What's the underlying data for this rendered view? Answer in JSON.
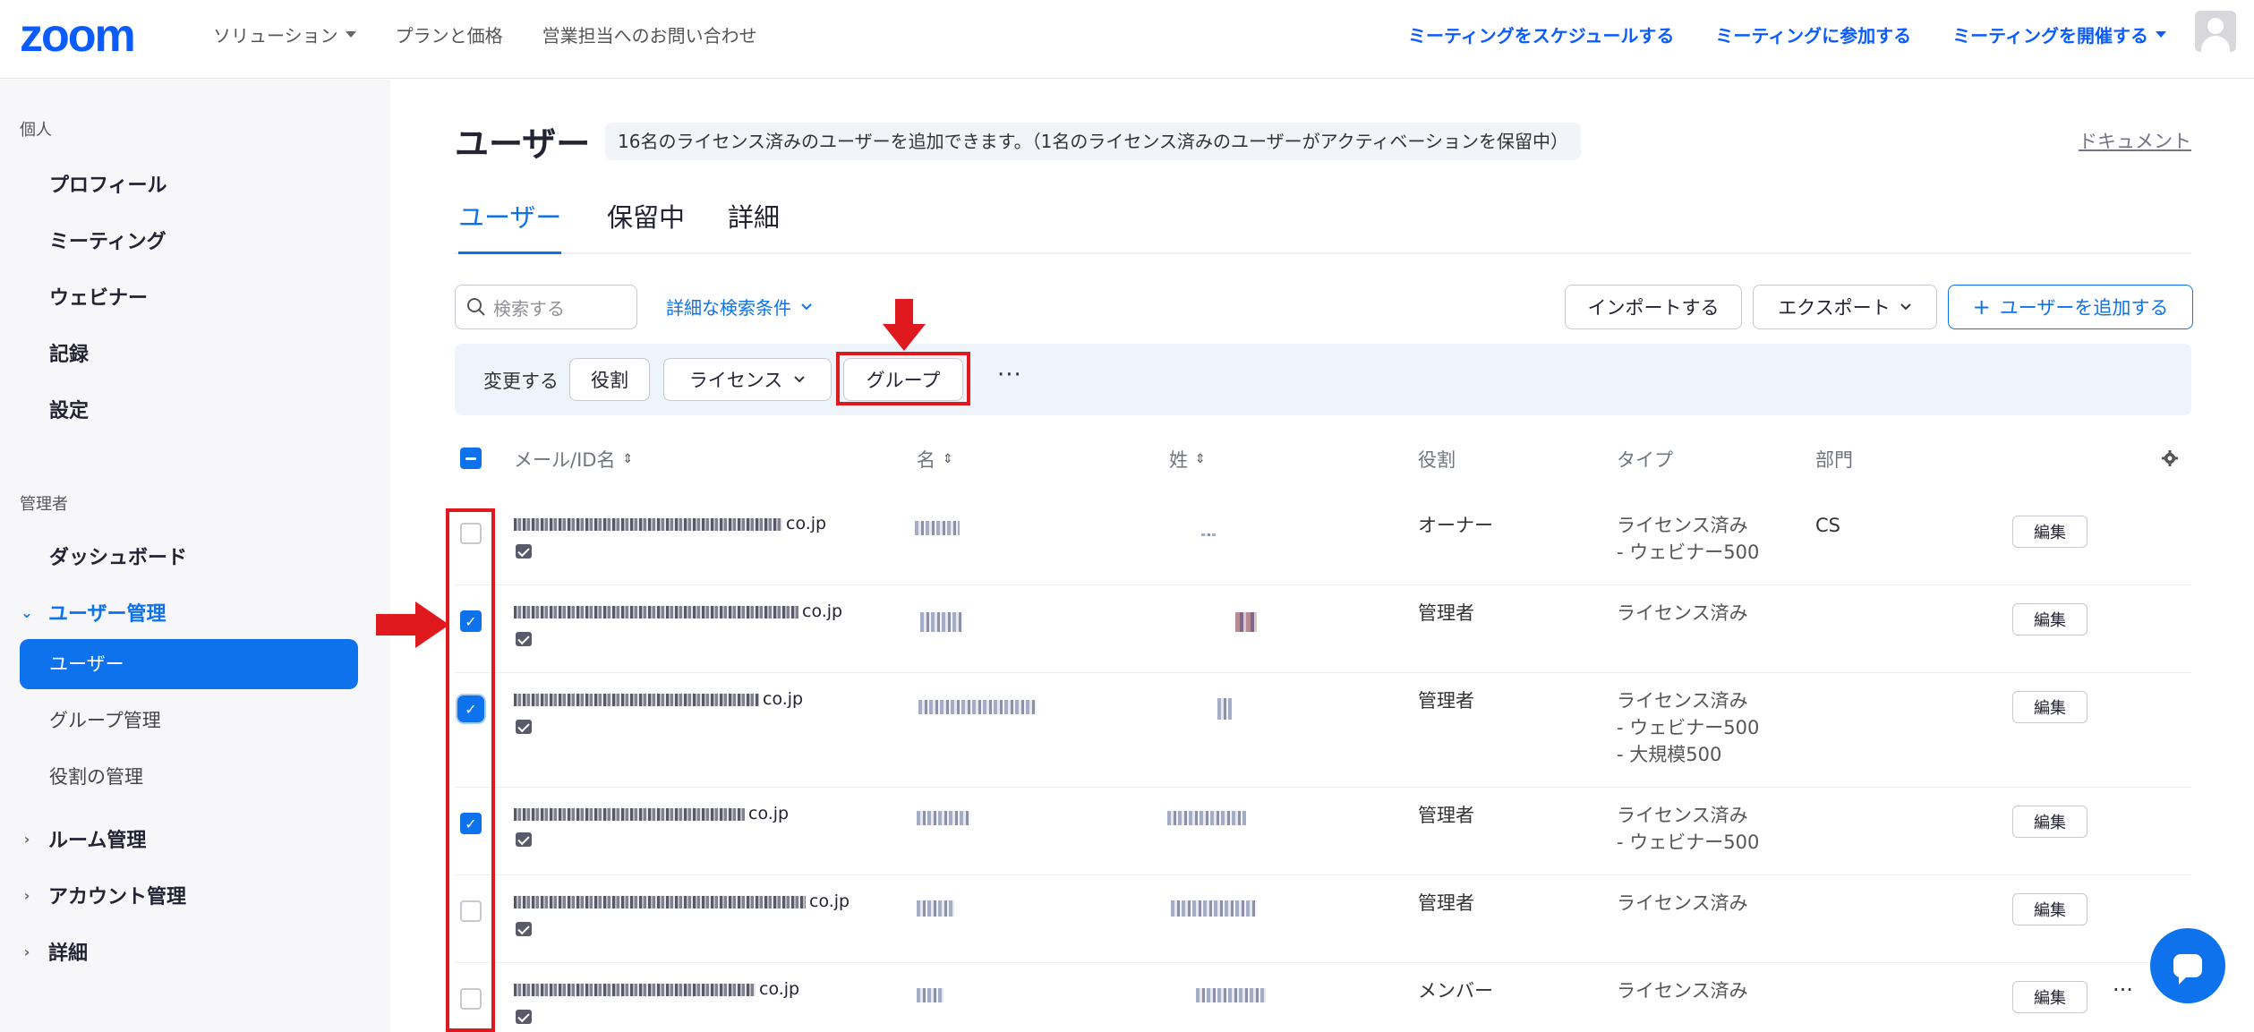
{
  "header": {
    "logo": "zoom",
    "nav_left": [
      "ソリューション",
      "プランと価格",
      "営業担当へのお問い合わせ"
    ],
    "nav_right": [
      "ミーティングをスケジュールする",
      "ミーティングに参加する",
      "ミーティングを開催する"
    ]
  },
  "sidebar": {
    "personal_label": "個人",
    "personal_items": [
      "プロフィール",
      "ミーティング",
      "ウェビナー",
      "記録",
      "設定"
    ],
    "admin_label": "管理者",
    "dashboard": "ダッシュボード",
    "user_mgmt": "ユーザー管理",
    "user_mgmt_items": [
      "ユーザー",
      "グループ管理",
      "役割の管理"
    ],
    "room_mgmt": "ルーム管理",
    "account_mgmt": "アカウント管理",
    "advanced": "詳細"
  },
  "page": {
    "title": "ユーザー",
    "license_note": "16名のライセンス済みのユーザーを追加できます。（1名のライセンス済みのユーザーがアクティベーションを保留中）",
    "doc_link": "ドキュメント",
    "tabs": [
      "ユーザー",
      "保留中",
      "詳細"
    ]
  },
  "toolbar": {
    "search_placeholder": "検索する",
    "advanced_search": "詳細な検索条件",
    "import": "インポートする",
    "export": "エクスポート",
    "add_user": "ユーザーを追加する"
  },
  "action_bar": {
    "label": "変更する",
    "role": "役割",
    "license": "ライセンス",
    "group": "グループ",
    "more": "···"
  },
  "table": {
    "headers": [
      "メール/ID名",
      "名",
      "姓",
      "役割",
      "タイプ",
      "部門"
    ],
    "edit_label": "編集",
    "rows": [
      {
        "checked": false,
        "email_suffix": "co.jp",
        "role": "オーナー",
        "type": [
          "ライセンス済み",
          "- ウェビナー500"
        ],
        "dept": "CS"
      },
      {
        "checked": true,
        "email_suffix": "co.jp",
        "role": "管理者",
        "type": [
          "ライセンス済み"
        ],
        "dept": ""
      },
      {
        "checked": true,
        "email_suffix": "co.jp",
        "role": "管理者",
        "type": [
          "ライセンス済み",
          "- ウェビナー500",
          "- 大規模500"
        ],
        "dept": ""
      },
      {
        "checked": true,
        "email_suffix": "co.jp",
        "role": "管理者",
        "type": [
          "ライセンス済み",
          "- ウェビナー500"
        ],
        "dept": ""
      },
      {
        "checked": false,
        "email_suffix": "co.jp",
        "role": "管理者",
        "type": [
          "ライセンス済み"
        ],
        "dept": ""
      },
      {
        "checked": false,
        "email_suffix": "co.jp",
        "role": "メンバー",
        "type": [
          "ライセンス済み"
        ],
        "dept": ""
      }
    ]
  },
  "colors": {
    "brand": "#0b5cff",
    "accent": "#0e72ed",
    "annotation": "#e0191f"
  }
}
